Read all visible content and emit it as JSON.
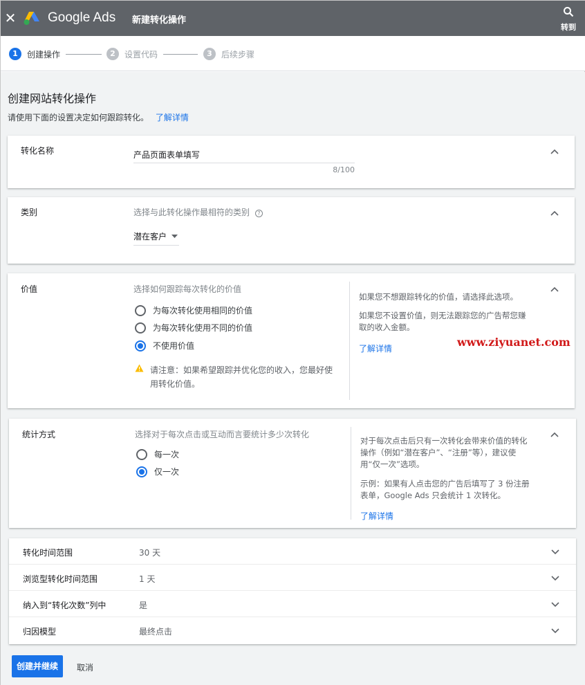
{
  "header": {
    "close_icon": "close-icon",
    "brand": "Google Ads",
    "title": "新建转化操作",
    "goto_label": "转到"
  },
  "stepper": {
    "steps": [
      {
        "num": "1",
        "label": "创建操作",
        "active": true
      },
      {
        "num": "2",
        "label": "设置代码",
        "active": false
      },
      {
        "num": "3",
        "label": "后续步骤",
        "active": false
      }
    ]
  },
  "page": {
    "title": "创建网站转化操作",
    "subtitle": "请使用下面的设置决定如何跟踪转化。",
    "learn_more": "了解详情"
  },
  "conversion_name": {
    "label": "转化名称",
    "value": "产品页面表单填写",
    "counter": "8/100"
  },
  "category": {
    "label": "类别",
    "hint": "选择与此转化操作最相符的类别",
    "help_icon": "help-icon",
    "selected": "潜在客户"
  },
  "value": {
    "label": "价值",
    "hint": "选择如何跟踪每次转化的价值",
    "options": [
      {
        "label": "为每次转化使用相同的价值",
        "checked": false
      },
      {
        "label": "为每次转化使用不同的价值",
        "checked": false
      },
      {
        "label": "不使用价值",
        "checked": true
      }
    ],
    "warning": "请注意：如果希望跟踪并优化您的收入，您最好使用转化价值。",
    "warning_line1": "请注意：如果希望跟踪并优化您的收入，您最好使",
    "warning_line2": "用转化价值。",
    "side_p1": "如果您不想跟踪转化的价值，请选择此选项。",
    "side_p2_line1": "如果您不设置价值，则无法跟踪您的广告帮您赚",
    "side_p2_line2": "取的收入金额。",
    "side_link": "了解详情"
  },
  "count": {
    "label": "统计方式",
    "hint": "选择对于每次点击或互动而言要统计多少次转化",
    "options": [
      {
        "label": "每一次",
        "checked": false
      },
      {
        "label": "仅一次",
        "checked": true
      }
    ],
    "side_p1_line1": "对于每次点击后只有一次转化会带来价值的转化",
    "side_p1_line2": "操作（例如“潜在客户”、“注册”等），建议使",
    "side_p1_line3": "用“仅一次”选项。",
    "side_p2_line1": "示例：如果有人点击您的广告后填写了 3 份注册",
    "side_p2_line2": "表单，Google Ads 只会统计 1 次转化。",
    "side_link": "了解详情"
  },
  "settings_rows": [
    {
      "label": "转化时间范围",
      "value": "30 天"
    },
    {
      "label": "浏览型转化时间范围",
      "value": "1 天"
    },
    {
      "label": "纳入到“转化次数”列中",
      "value": "是"
    },
    {
      "label": "归因模型",
      "value": "最终点击"
    }
  ],
  "actions": {
    "primary": "创建并继续",
    "cancel": "取消"
  },
  "watermark": "www.ziyuanet.com",
  "colors": {
    "header_bg": "#5f6368",
    "accent": "#1a73e8",
    "warning": "#fbbc04",
    "watermark": "#d11a1a"
  }
}
